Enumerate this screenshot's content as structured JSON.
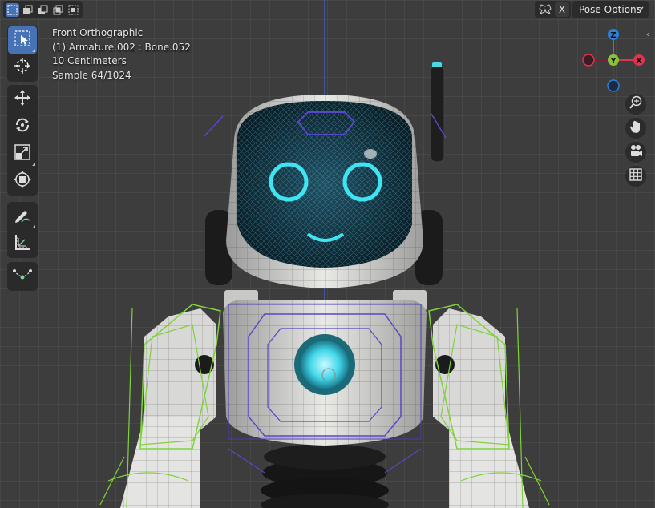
{
  "viewport": {
    "overlay_lines": [
      "Front Orthographic",
      "(1) Armature.002 : Bone.052",
      "10 Centimeters",
      "Sample 64/1024"
    ]
  },
  "header": {
    "select_modes": [
      "select-new-icon",
      "select-extend-icon",
      "select-subtract-icon",
      "select-difference-icon",
      "select-intersect-icon"
    ],
    "active_select_mode": 0,
    "x_label": "X",
    "pose_options_label": "Pose Options"
  },
  "toolbar": {
    "groups": [
      [
        "select-box-icon",
        "cursor-icon"
      ],
      [
        "move-icon",
        "rotate-icon",
        "scale-icon",
        "transform-icon"
      ],
      [
        "annotate-icon",
        "measure-icon"
      ],
      [
        "relax-icon"
      ]
    ],
    "active_tool": "select-box-icon"
  },
  "gizmo": {
    "axes": [
      "Z",
      "Y",
      "X"
    ],
    "colors": {
      "x": "#e0334c",
      "y": "#8bc03a",
      "z": "#2e7fd6"
    }
  },
  "nav_buttons": [
    "zoom-icon",
    "pan-hand-icon",
    "camera-icon",
    "grid-view-icon"
  ]
}
